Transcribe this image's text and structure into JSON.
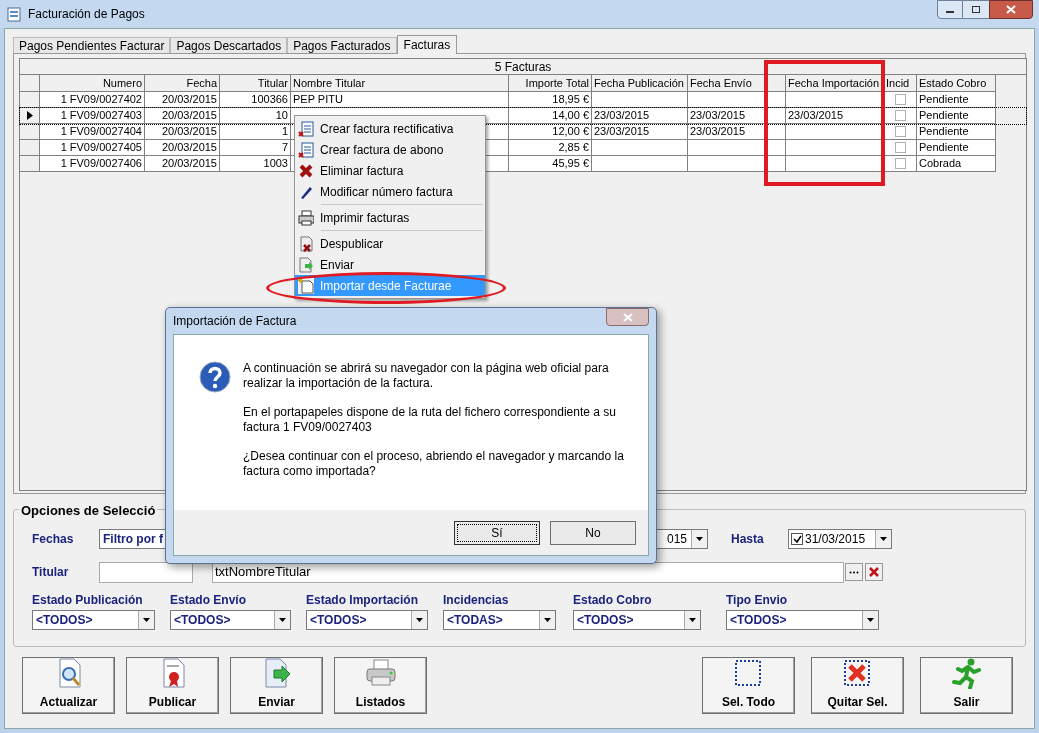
{
  "window": {
    "title": "Facturación de Pagos"
  },
  "tabs": [
    {
      "label": "Pagos Pendientes Facturar",
      "selected": false
    },
    {
      "label": "Pagos Descartados",
      "selected": false
    },
    {
      "label": "Pagos Facturados",
      "selected": false
    },
    {
      "label": "Facturas",
      "selected": true
    }
  ],
  "grid": {
    "caption": "5 Facturas",
    "columns": [
      "Numero",
      "Fecha",
      "Titular",
      "Nombre Titular",
      "Importe Total",
      "Fecha Publicación",
      "Fecha Envío",
      "Fecha Importación",
      "Incid",
      "Estado Cobro"
    ],
    "rows": [
      {
        "selected": false,
        "numero": "1 FV09/0027402",
        "fecha": "20/03/2015",
        "titular": "100366",
        "nombre_titular": "PEP PITU",
        "importe_total": "18,95 €",
        "fecha_publicacion": "",
        "fecha_envio": "",
        "fecha_importacion": "",
        "incid": false,
        "estado_cobro": "Pendiente"
      },
      {
        "selected": true,
        "numero": "1 FV09/0027403",
        "fecha": "20/03/2015",
        "titular": "10",
        "importe_total": "14,00 €",
        "fecha_publicacion": "23/03/2015",
        "fecha_envio": "23/03/2015",
        "fecha_importacion": "23/03/2015",
        "incid": false,
        "estado_cobro": "Pendiente"
      },
      {
        "selected": false,
        "numero": "1 FV09/0027404",
        "fecha": "20/03/2015",
        "titular": "1",
        "importe_total": "12,00 €",
        "fecha_publicacion": "23/03/2015",
        "fecha_envio": "23/03/2015",
        "fecha_importacion": "",
        "incid": false,
        "estado_cobro": "Pendiente"
      },
      {
        "selected": false,
        "numero": "1 FV09/0027405",
        "fecha": "20/03/2015",
        "titular": "7",
        "importe_total": "2,85 €",
        "fecha_publicacion": "",
        "fecha_envio": "",
        "fecha_importacion": "",
        "incid": false,
        "estado_cobro": "Pendiente"
      },
      {
        "selected": false,
        "numero": "1 FV09/0027406",
        "fecha": "20/03/2015",
        "titular": "1003",
        "importe_total": "45,95 €",
        "fecha_publicacion": "",
        "fecha_envio": "",
        "fecha_importacion": "",
        "incid": false,
        "estado_cobro": "Cobrada"
      }
    ]
  },
  "context_menu": {
    "groups": [
      [
        {
          "label": "Crear factura rectificativa",
          "selected": false
        },
        {
          "label": "Crear factura de abono",
          "selected": false
        },
        {
          "label": "Eliminar factura",
          "selected": false
        },
        {
          "label": "Modificar número factura",
          "selected": false
        }
      ],
      [
        {
          "label": "Imprimir facturas",
          "selected": false
        }
      ],
      [
        {
          "label": "Despublicar",
          "selected": false
        },
        {
          "label": "Enviar",
          "selected": false
        },
        {
          "label": "Importar desde Facturae",
          "selected": true
        }
      ]
    ]
  },
  "options": {
    "title": "Opciones de Selecció",
    "fechas_label": "Fechas",
    "fechas_filter": "Filtro por f",
    "desde_value": "015",
    "hasta_label": "Hasta",
    "hasta_checked": true,
    "hasta_value": "31/03/2015",
    "titular_label": "Titular",
    "titular_name": "txtNombreTitular",
    "filters": [
      {
        "label": "Estado Publicación",
        "value": "<TODOS>"
      },
      {
        "label": "Estado Envío",
        "value": "<TODOS>"
      },
      {
        "label": "Estado Importación",
        "value": "<TODOS>"
      },
      {
        "label": "Incidencias",
        "value": "<TODAS>"
      },
      {
        "label": "Estado Cobro",
        "value": "<TODOS>"
      },
      {
        "label": "Tipo Envio",
        "value": "<TODOS>"
      }
    ]
  },
  "left_buttons": [
    {
      "label": "Actualizar"
    },
    {
      "label": "Publicar"
    },
    {
      "label": "Enviar"
    },
    {
      "label": "Listados"
    }
  ],
  "right_buttons": [
    {
      "label": "Sel. Todo"
    },
    {
      "label": "Quitar Sel."
    },
    {
      "label": "Salir"
    }
  ],
  "dialog": {
    "title": "Importación de Factura",
    "paragraphs": [
      "A continuación se abrirá su navegador con la página web oficial para realizar la importación de la factura.",
      "En el portapapeles dispone de la ruta del fichero correspondiente a su factura 1 FV09/0027403",
      "¿Desea continuar con el proceso, abriendo el navegador y marcando la factura como importada?"
    ],
    "buttons": [
      {
        "label": "Sí",
        "focused": true
      },
      {
        "label": "No",
        "focused": false
      }
    ]
  },
  "annotations": [
    {
      "kind": "rectangle"
    },
    {
      "kind": "ellipse"
    }
  ]
}
